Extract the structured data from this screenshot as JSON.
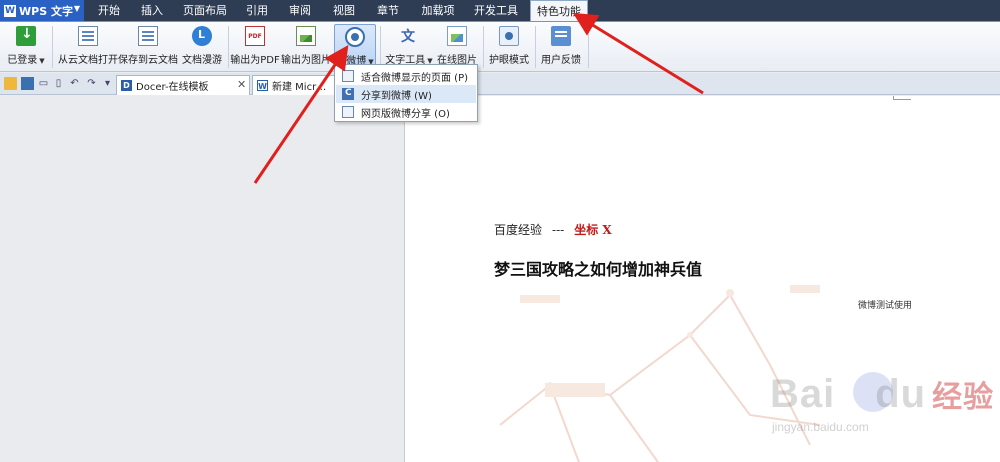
{
  "app": {
    "logo_text": "WPS 文字"
  },
  "menu": {
    "tabs": [
      "开始",
      "插入",
      "页面布局",
      "引用",
      "审阅",
      "视图",
      "章节",
      "加载项",
      "开发工具",
      "特色功能"
    ],
    "active": "特色功能"
  },
  "ribbon": {
    "logged_in": "已登录",
    "open_cloud": "从云文档打开",
    "save_cloud": "保存到云文档",
    "doc_roam": "文档漫游",
    "export_pdf": "输出为PDF",
    "export_image": "输出为图片",
    "long_weibo": "长微博",
    "text_tools": "文字工具",
    "online_image": "在线图片",
    "eye_mode": "护眼模式",
    "user_feedback": "用户反馈"
  },
  "dropdown": {
    "items": [
      {
        "label": "适合微博显示的页面 (P)"
      },
      {
        "label": "分享到微博 (W)"
      },
      {
        "label": "网页版微博分享 (O)"
      }
    ]
  },
  "tabs": {
    "items": [
      {
        "label": "Docer-在线模板"
      },
      {
        "label": "新建 Micr…"
      }
    ]
  },
  "document": {
    "line1_left": "百度经验",
    "line1_sep": "---",
    "line1_right": "坐标 X",
    "title": "梦三国攻略之如何增加神兵值",
    "note": "微博测试使用"
  },
  "watermark": {
    "brand": "Bai",
    "brand_rest": "du",
    "brand_cn": "经验",
    "url": "jingyan.baidu.com"
  },
  "colors": {
    "menubar": "#2e3d54",
    "logo": "#2a61c4",
    "arrow": "#e0201c",
    "highlight_text": "#c61b1b"
  }
}
